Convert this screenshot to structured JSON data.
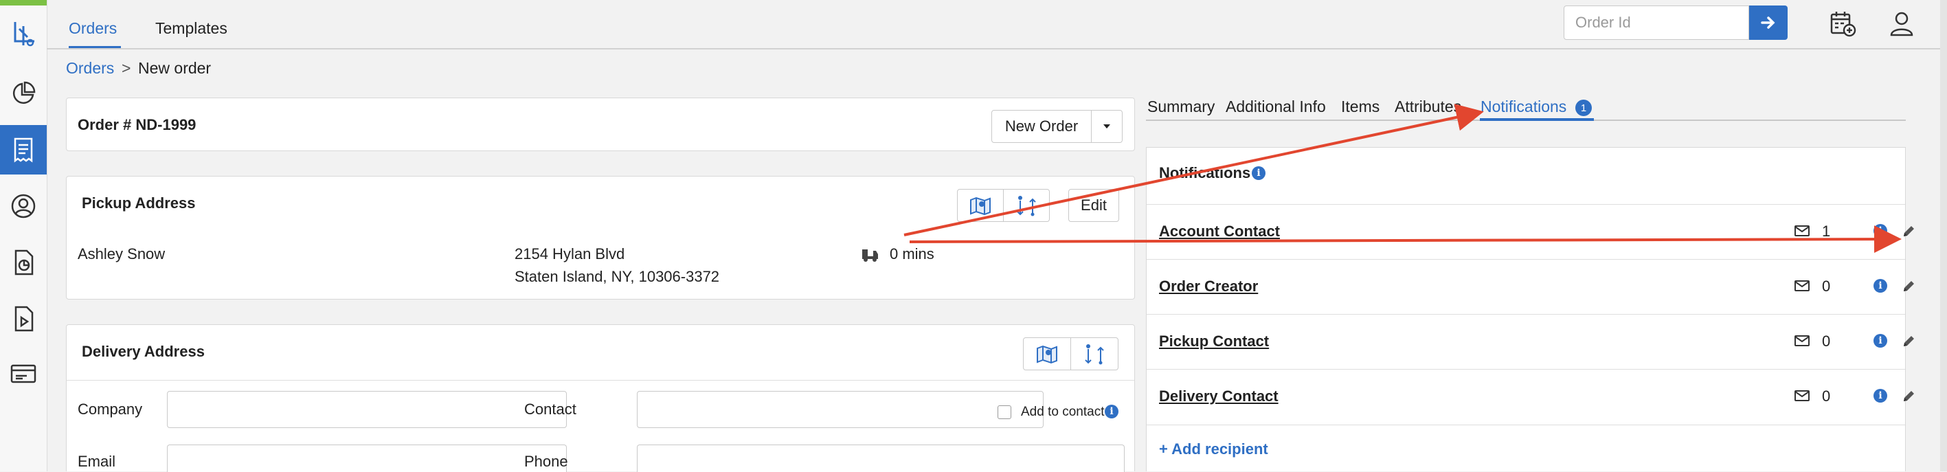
{
  "nav": {
    "tabs": [
      {
        "label": "Orders",
        "active": true
      },
      {
        "label": "Templates",
        "active": false
      }
    ],
    "search": {
      "placeholder": "Order Id",
      "value": ""
    }
  },
  "sidebar": {
    "items": [
      {
        "icon": "logo-icon"
      },
      {
        "icon": "pie-chart-icon"
      },
      {
        "icon": "receipt-icon",
        "active": true
      },
      {
        "icon": "user-circle-icon"
      },
      {
        "icon": "document-chart-icon"
      },
      {
        "icon": "document-play-icon"
      },
      {
        "icon": "card-icon"
      }
    ]
  },
  "breadcrumb": {
    "root": "Orders",
    "separator": ">",
    "current": "New order"
  },
  "order": {
    "title": "Order # ND-1999",
    "new_order_label": "New Order"
  },
  "pickup": {
    "title": "Pickup Address",
    "edit_label": "Edit",
    "name": "Ashley Snow",
    "address_line1": "2154 Hylan Blvd",
    "address_line2": "Staten Island, NY, 10306-3372",
    "eta": "0 mins"
  },
  "delivery": {
    "title": "Delivery Address",
    "company_label": "Company",
    "contact_label": "Contact",
    "add_to_contact_label": "Add to contact",
    "email_label": "Email",
    "phone_label": "Phone"
  },
  "right_tabs": [
    {
      "label": "Summary",
      "active": false
    },
    {
      "label": "Additional Info",
      "active": false
    },
    {
      "label": "Items",
      "active": false
    },
    {
      "label": "Attributes",
      "active": false
    },
    {
      "label": "Notifications",
      "active": true,
      "badge": "1"
    }
  ],
  "notifications": {
    "title": "Notifications",
    "recipients": [
      {
        "name": "Account Contact",
        "count": "1"
      },
      {
        "name": "Order Creator",
        "count": "0"
      },
      {
        "name": "Pickup Contact",
        "count": "0"
      },
      {
        "name": "Delivery Contact",
        "count": "0"
      }
    ],
    "add_label": "+ Add recipient"
  },
  "colors": {
    "accent": "#2f6fc4",
    "brand_green": "#7cc144",
    "annotation_arrow": "#e2462f"
  }
}
